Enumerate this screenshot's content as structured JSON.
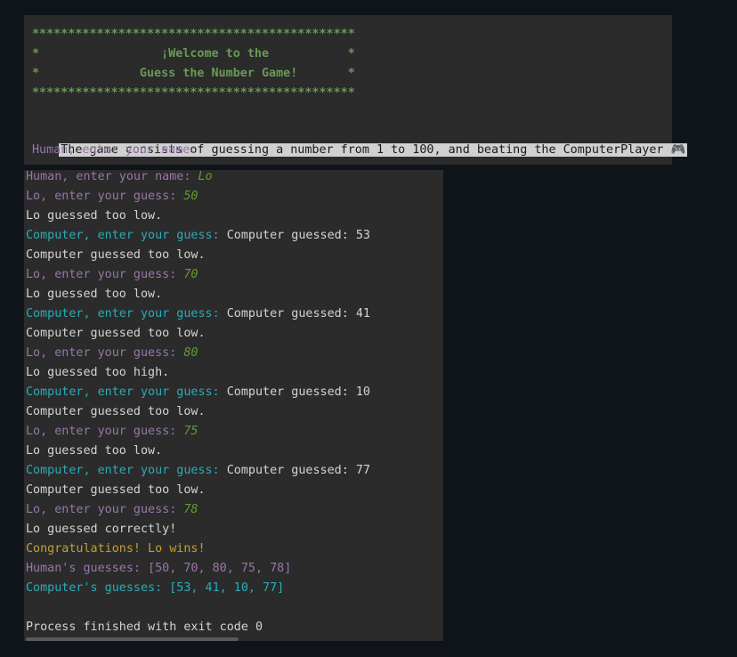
{
  "banner": {
    "line1": "*********************************************",
    "line2": "*                 ¡Welcome to the           *",
    "line3": "*              Guess the Number Game!       *",
    "line4": "*********************************************"
  },
  "intro": {
    "description": "The game consists of guessing a number from 1 to 100, and beating the ComputerPlayer",
    "gamepad_icon": "🎮",
    "name_prompt": "Human, enter your name:"
  },
  "console": [
    {
      "parts": [
        {
          "text": "Human, enter your name: ",
          "style": "purple"
        },
        {
          "text": "Lo",
          "style": "input"
        }
      ]
    },
    {
      "parts": [
        {
          "text": "Lo, enter your guess: ",
          "style": "purple"
        },
        {
          "text": "50",
          "style": "input"
        }
      ]
    },
    {
      "parts": [
        {
          "text": "Lo guessed too low.",
          "style": "white"
        }
      ]
    },
    {
      "parts": [
        {
          "text": "Computer, enter your guess: ",
          "style": "cyan"
        },
        {
          "text": "Computer guessed: 53",
          "style": "white"
        }
      ]
    },
    {
      "parts": [
        {
          "text": "Computer guessed too low.",
          "style": "white"
        }
      ]
    },
    {
      "parts": [
        {
          "text": "Lo, enter your guess: ",
          "style": "purple"
        },
        {
          "text": "70",
          "style": "input"
        }
      ]
    },
    {
      "parts": [
        {
          "text": "Lo guessed too low.",
          "style": "white"
        }
      ]
    },
    {
      "parts": [
        {
          "text": "Computer, enter your guess: ",
          "style": "cyan"
        },
        {
          "text": "Computer guessed: 41",
          "style": "white"
        }
      ]
    },
    {
      "parts": [
        {
          "text": "Computer guessed too low.",
          "style": "white"
        }
      ]
    },
    {
      "parts": [
        {
          "text": "Lo, enter your guess: ",
          "style": "purple"
        },
        {
          "text": "80",
          "style": "input"
        }
      ]
    },
    {
      "parts": [
        {
          "text": "Lo guessed too high.",
          "style": "white"
        }
      ]
    },
    {
      "parts": [
        {
          "text": "Computer, enter your guess: ",
          "style": "cyan"
        },
        {
          "text": "Computer guessed: 10",
          "style": "white"
        }
      ]
    },
    {
      "parts": [
        {
          "text": "Computer guessed too low.",
          "style": "white"
        }
      ]
    },
    {
      "parts": [
        {
          "text": "Lo, enter your guess: ",
          "style": "purple"
        },
        {
          "text": "75",
          "style": "input"
        }
      ]
    },
    {
      "parts": [
        {
          "text": "Lo guessed too low.",
          "style": "white"
        }
      ]
    },
    {
      "parts": [
        {
          "text": "Computer, enter your guess: ",
          "style": "cyan"
        },
        {
          "text": "Computer guessed: 77",
          "style": "white"
        }
      ]
    },
    {
      "parts": [
        {
          "text": "Computer guessed too low.",
          "style": "white"
        }
      ]
    },
    {
      "parts": [
        {
          "text": "Lo, enter your guess: ",
          "style": "purple"
        },
        {
          "text": "78",
          "style": "input"
        }
      ]
    },
    {
      "parts": [
        {
          "text": "Lo guessed correctly!",
          "style": "white"
        }
      ]
    },
    {
      "parts": [
        {
          "text": "Congratulations! Lo wins!",
          "style": "orange"
        }
      ]
    },
    {
      "parts": [
        {
          "text": "Human's guesses: [50, 70, 80, 75, 78]",
          "style": "purple"
        }
      ]
    },
    {
      "parts": [
        {
          "text": "Computer's guesses: [53, 41, 10, 77]",
          "style": "cyan"
        }
      ]
    },
    {
      "parts": []
    },
    {
      "parts": [
        {
          "text": "Process finished with exit code 0",
          "style": "white"
        }
      ]
    }
  ],
  "colors": {
    "background": "#0f131a",
    "panel": "#2b2b2b",
    "prompt_human": "#9876aa",
    "prompt_computer": "#2aacb8",
    "user_input": "#5f9e2f",
    "success": "#c2a030",
    "banner": "#6a9955"
  }
}
